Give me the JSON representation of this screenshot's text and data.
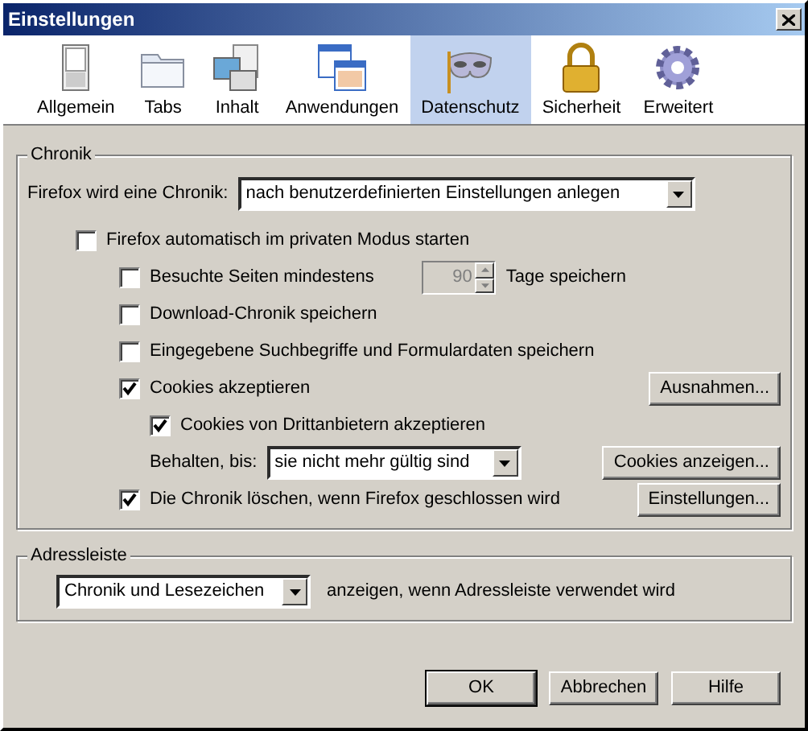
{
  "window": {
    "title": "Einstellungen"
  },
  "toolbar": [
    {
      "label": "Allgemein",
      "selected": false
    },
    {
      "label": "Tabs",
      "selected": false
    },
    {
      "label": "Inhalt",
      "selected": false
    },
    {
      "label": "Anwendungen",
      "selected": false
    },
    {
      "label": "Datenschutz",
      "selected": true
    },
    {
      "label": "Sicherheit",
      "selected": false
    },
    {
      "label": "Erweitert",
      "selected": false
    }
  ],
  "history": {
    "legend": "Chronik",
    "mode_label": "Firefox wird eine Chronik:",
    "mode_value": "nach benutzerdefinierten Einstellungen anlegen",
    "options": [
      {
        "kind": "checkbox",
        "label": "Firefox automatisch im privaten Modus starten",
        "checked": false,
        "children": [
          {
            "kind": "checkbox",
            "label": "Besuchte Seiten mindestens",
            "checked": false,
            "days": {
              "value": "90",
              "disabled": true
            },
            "suffix": "Tage speichern"
          },
          {
            "kind": "checkbox",
            "label": "Download-Chronik speichern",
            "checked": false
          },
          {
            "kind": "checkbox",
            "label": "Eingegebene Suchbegriffe und Formulardaten speichern",
            "checked": false
          },
          {
            "kind": "checkbox",
            "label": "Cookies akzeptieren",
            "checked": true,
            "button": "Ausnahmen...",
            "children": [
              {
                "kind": "checkbox",
                "label": "Cookies von Drittanbietern akzeptieren",
                "checked": true
              },
              {
                "kind": "select",
                "label": "Behalten, bis:",
                "value": "sie nicht mehr gültig sind",
                "button": "Cookies anzeigen..."
              }
            ]
          },
          {
            "kind": "checkbox",
            "label": "Die Chronik löschen, wenn Firefox geschlossen wird",
            "checked": true,
            "button": "Einstellungen..."
          }
        ]
      }
    ]
  },
  "address_bar": {
    "legend": "Adressleiste",
    "value": "Chronik und Lesezeichen",
    "text": "anzeigen, wenn Adressleiste verwendet wird"
  },
  "buttons": [
    "OK",
    "Abbrechen",
    "Hilfe"
  ]
}
